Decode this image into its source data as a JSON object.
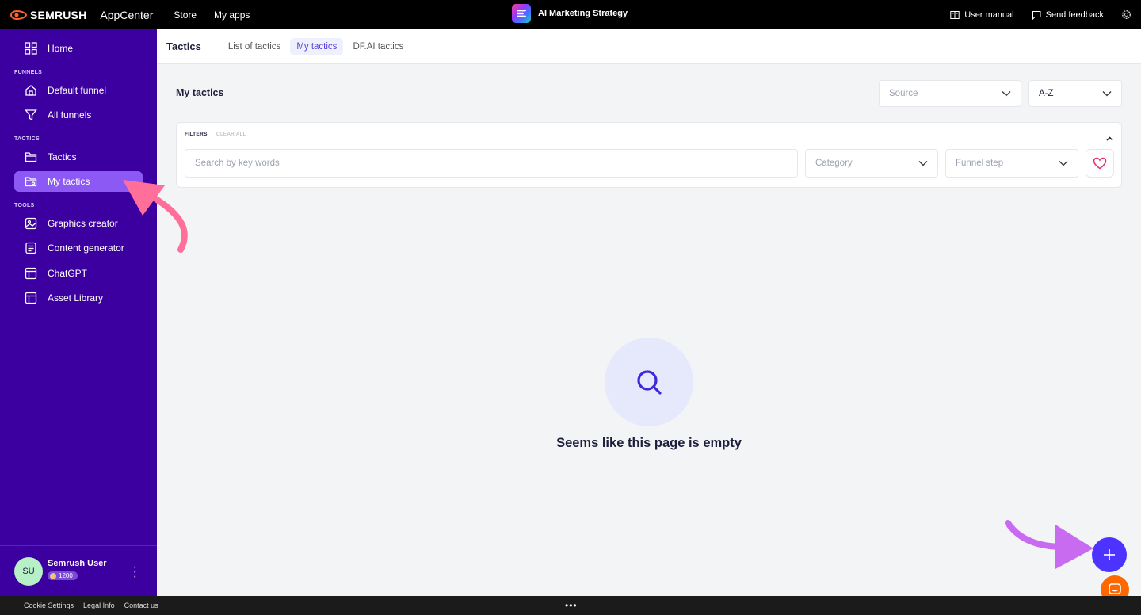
{
  "topbar": {
    "brand_name": "SEMRUSH",
    "brand_app": "AppCenter",
    "nav": [
      "Store",
      "My apps"
    ],
    "app_title": "AI Marketing Strategy",
    "user_manual": "User manual",
    "send_feedback": "Send feedback"
  },
  "sidebar": {
    "home": "Home",
    "funnels_label": "FUNNELS",
    "default_funnel": "Default funnel",
    "all_funnels": "All funnels",
    "tactics_label": "TACTICS",
    "tactics": "Tactics",
    "my_tactics": "My tactics",
    "tools_label": "TOOLS",
    "graphics_creator": "Graphics creator",
    "content_generator": "Content generator",
    "chatgpt": "ChatGPT",
    "asset_library": "Asset Library"
  },
  "user": {
    "initials": "SU",
    "name": "Semrush User",
    "credits": "1200"
  },
  "header": {
    "title": "Tactics",
    "tabs": [
      "List of tactics",
      "My tactics",
      "DF.AI tactics"
    ]
  },
  "main": {
    "section_title": "My tactics",
    "source_placeholder": "Source",
    "sort_value": "A-Z",
    "filters_label": "FILTERS",
    "clear_all": "CLEAR ALL",
    "search_placeholder": "Search by key words",
    "category_placeholder": "Category",
    "funnel_step_placeholder": "Funnel step",
    "empty_message": "Seems like this page is empty"
  },
  "footer": {
    "links": [
      "Cookie Settings",
      "Legal Info",
      "Contact us"
    ],
    "more": "•••"
  },
  "colors": {
    "sidebar_bg": "#3c00a0",
    "sidebar_active": "#8d59f5",
    "accent": "#4d33ff",
    "chat": "#ff6700",
    "annotation_pink": "#ff6f9a",
    "annotation_purple": "#c96bf0"
  }
}
